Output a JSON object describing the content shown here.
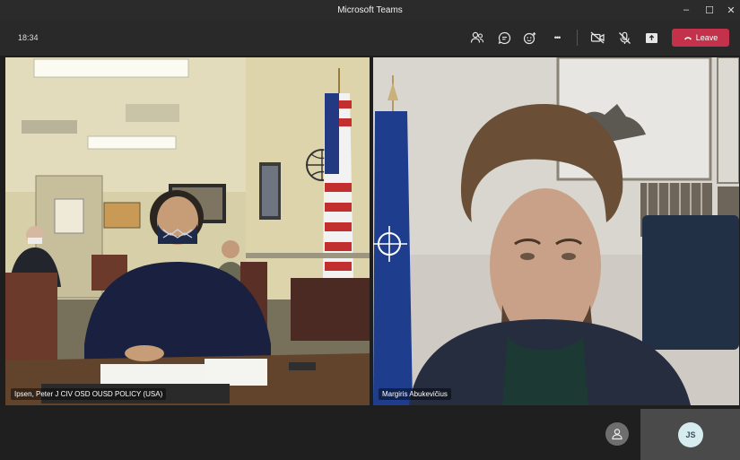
{
  "window": {
    "title": "Microsoft Teams",
    "min_glyph": "–",
    "max_glyph": "☐",
    "close_glyph": "✕"
  },
  "toolbar": {
    "time": "18:34",
    "participants_icon": "people-icon",
    "chat_icon": "chat-icon",
    "reactions_icon": "reactions-icon",
    "more_glyph": "•••",
    "camera_icon": "camera-off-icon",
    "mic_icon": "mic-off-icon",
    "share_icon": "share-icon",
    "leave_label": "Leave",
    "leave_color": "#c4314b"
  },
  "videos": [
    {
      "name": "Ipsen, Peter J CIV OSD OUSD POLICY (USA)"
    },
    {
      "name": "Margiris Abukevičius"
    }
  ],
  "strip": {
    "guest_avatar_icon": "person-icon",
    "self_initials": "JS"
  }
}
